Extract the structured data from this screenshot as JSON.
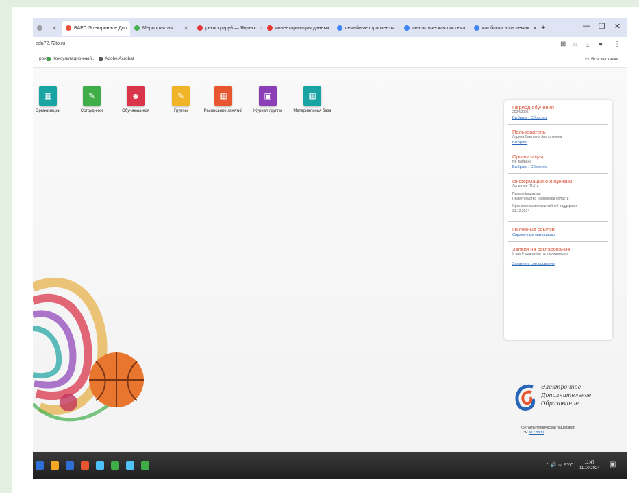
{
  "browser": {
    "tabs": [
      {
        "label": "",
        "color": "#9aa0a6",
        "active": false
      },
      {
        "label": "БАРС.Электронное Доп...",
        "color": "#e3533b",
        "active": true
      },
      {
        "label": "Мероприятия",
        "color": "#4caf50",
        "active": false
      },
      {
        "label": "регистрируй — Яндекс",
        "color": "#e53935",
        "active": false
      },
      {
        "label": "инвентаризация данных",
        "color": "#e53935",
        "active": false
      },
      {
        "label": "семейные фрагменты",
        "color": "#4285f4",
        "active": false
      },
      {
        "label": "аналитическая система",
        "color": "#4285f4",
        "active": false
      },
      {
        "label": "как блоки в системах",
        "color": "#4285f4",
        "active": false
      }
    ],
    "new_tab": "+",
    "window_controls": {
      "minimize": "—",
      "restore": "❐",
      "close": "✕"
    },
    "url": "edu72.72to.ru",
    "bookmarks": [
      {
        "label": "рон",
        "color": "#ffffff"
      },
      {
        "label": "Консультационный...",
        "color": "#43a047"
      },
      {
        "label": "Adobe Acrobat",
        "color": "#555555"
      }
    ],
    "all_bookmarks": "Все закладки"
  },
  "apps": [
    {
      "label": "Организации",
      "icon": "building-icon",
      "color": "#1aa3a3"
    },
    {
      "label": "Сотрудники",
      "icon": "employee-icon",
      "color": "#3fae49"
    },
    {
      "label": "Обучающиеся",
      "icon": "students-icon",
      "color": "#d9364b"
    },
    {
      "label": "Группы",
      "icon": "groups-icon",
      "color": "#f0b428"
    },
    {
      "label": "Расписание занятий",
      "icon": "schedule-icon",
      "color": "#e8562f"
    },
    {
      "label": "Журнал группы",
      "icon": "journal-icon",
      "color": "#8a3fb7"
    },
    {
      "label": "Материальная база",
      "icon": "materials-icon",
      "color": "#1aa3a3"
    }
  ],
  "info_panel": {
    "period": {
      "title": "Период обучения",
      "value": "2024/2025",
      "link": "Выбрать / Сбросить"
    },
    "user": {
      "title": "Пользователь",
      "value": "Ларина Светлана Анатольевна",
      "link": "Выбрать"
    },
    "organization": {
      "title": "Организация",
      "value": "Не выбрана",
      "link": "Выбрать / Сбросить"
    },
    "license": {
      "title": "Информация о лицензии",
      "number": "Лицензия: 11414",
      "holder_label": "Правообладатель",
      "holder": "Правительство Тюменской области",
      "term_label": "Срок окончания гарантийной поддержки",
      "term": "31.12.2024"
    },
    "links": {
      "title": "Полезные ссылки",
      "link": "Справочные материалы"
    },
    "approvals": {
      "title": "Заявки на согласование",
      "text": "У вас 0 заявки(ок) на согласование",
      "link": "Заявки на согласование"
    }
  },
  "logo": {
    "line1": "Электронное",
    "line2": "Дополнительное",
    "line3": "Образование"
  },
  "support": {
    "text": "Контакты технической поддержки:",
    "prefix": "СЭР",
    "link": "sd.72to.ru"
  },
  "taskbar": {
    "apps": [
      "#2f6fd6",
      "#f5a623",
      "#2f6fd6",
      "#e8562f",
      "#4fc3f7",
      "#3fae49",
      "#4fc3f7",
      "#3fae49"
    ],
    "tray": "⌃ 🔊 ᯤ РУС",
    "time": "11:47",
    "date": "11.10.2024"
  }
}
